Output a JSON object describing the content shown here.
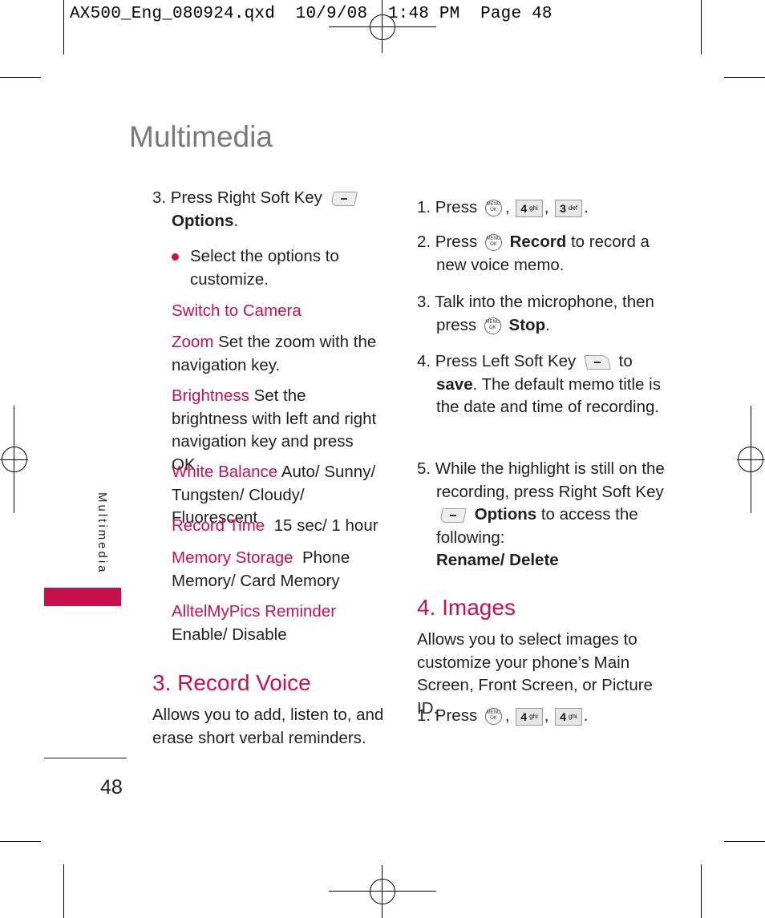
{
  "slug": "AX500_Eng_080924.qxd  10/9/08  1:48 PM  Page 48",
  "page_title": "Multimedia",
  "side_tab": "Multimedia",
  "page_number": "48",
  "left_col": {
    "step3_prefix": "3. Press Right Soft Key",
    "step3_bold": "Options",
    "step3_end": ".",
    "bullet_text": "Select the options to customize.",
    "options": [
      {
        "label": "Switch to Camera",
        "desc": ""
      },
      {
        "label": "Zoom",
        "desc": "Set the zoom with the navigation key."
      },
      {
        "label": "Brightness",
        "desc": "Set the brightness with left and right navigation key and press OK."
      },
      {
        "label": "White Balance",
        "desc": "Auto/ Sunny/ Tungsten/ Cloudy/ Fluorescent"
      },
      {
        "label": "Record Time",
        "desc": "15 sec/ 1 hour"
      },
      {
        "label": "Memory Storage",
        "desc": "Phone Memory/ Card Memory"
      },
      {
        "label": "AlltelMyPics Reminder",
        "desc": "Enable/ Disable"
      }
    ],
    "section_heading": "3. Record Voice",
    "section_desc": "Allows you to add, listen to, and erase short verbal reminders."
  },
  "right_col": {
    "steps": [
      {
        "prefix": "1. Press",
        "keys": [
          "MENU OK",
          "4 ghi",
          "3 def"
        ]
      },
      {
        "prefix": "2. Press",
        "bold": "Record",
        "rest": "to record a new voice memo."
      },
      {
        "prefix": "3. Talk into the microphone, then press",
        "bold": "Stop",
        "rest": "."
      },
      {
        "prefix": "4. Press Left Soft Key",
        "mid": "to",
        "bold": "save",
        "rest": ". The default memo title is the date and time of recording."
      },
      {
        "prefix": "5. While the highlight is still on the recording, press Right Soft Key",
        "bold": "Options",
        "rest": "to access the following:",
        "bold2": "Rename/ Delete"
      }
    ],
    "section_heading": "4. Images",
    "section_desc": "Allows you to select images to customize your phone’s Main Screen, Front Screen, or Picture ID.",
    "images_step1_prefix": "1. Press",
    "images_keys": [
      "MENU OK",
      "4 ghi",
      "4 ghi"
    ]
  },
  "keys": {
    "ok_top": "MENU",
    "ok_bottom": "OK",
    "k4": "4",
    "k4_sub": "ghi",
    "k3": "3",
    "k3_sub": "def"
  },
  "colors": {
    "accent": "#c8104d",
    "title_gray": "#7a7a7a"
  }
}
